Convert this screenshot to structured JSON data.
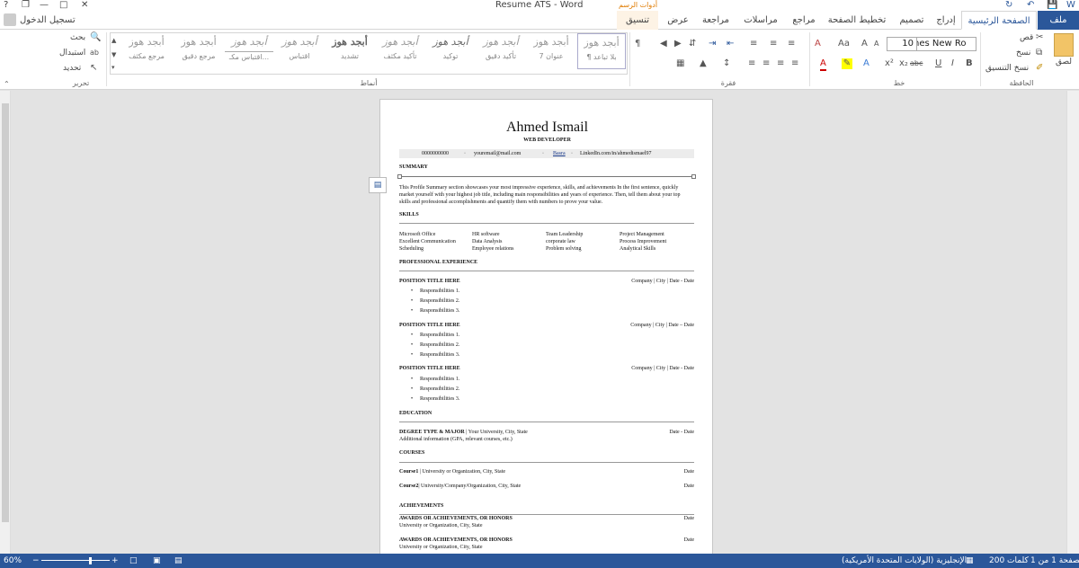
{
  "title_bar": {
    "doc_title": "Resume ATS - Word",
    "context_group": "أدوات الرسم",
    "help": "?",
    "minimize": "—",
    "restore": "❐",
    "close": "✕"
  },
  "tabs": {
    "file": "ملف",
    "home": "الصفحة الرئيسية",
    "insert": "إدراج",
    "design": "تصميم",
    "layout": "تخطيط الصفحة",
    "references": "مراجع",
    "mailings": "مراسلات",
    "review": "مراجعة",
    "view": "عرض",
    "format": "تنسيق",
    "sign_in": "تسجيل الدخول"
  },
  "ribbon": {
    "clipboard": {
      "label": "الحافظة",
      "paste": "لصق",
      "cut": "قص",
      "copy": "نسخ",
      "format_painter": "نسخ التنسيق"
    },
    "font": {
      "label": "خط",
      "name": "Times New Ro",
      "size": "10",
      "bold": "B",
      "italic": "I",
      "underline": "U",
      "strike": "abc",
      "sub": "x₂",
      "sup": "x²",
      "grow": "A",
      "shrink": "A",
      "case": "Aa",
      "clear": "A"
    },
    "paragraph": {
      "label": "فقرة"
    },
    "styles": {
      "label": "أنماط",
      "items": [
        {
          "sample": "أبجد هوز",
          "name": "¶ بلا تباعد"
        },
        {
          "sample": "أبجد هوز",
          "name": "عنوان 7"
        },
        {
          "sample": "أبجد هوز",
          "name": "تأكيد دقيق"
        },
        {
          "sample": "أبجد هوز",
          "name": "توكيد"
        },
        {
          "sample": "أبجد هوز",
          "name": "تأكيد مكثف"
        },
        {
          "sample": "أبجد هوز",
          "name": "تشديد"
        },
        {
          "sample": "أبجد هوز",
          "name": "اقتباس"
        },
        {
          "sample": "أبجد هوز",
          "name": "اقتباس مكـ..."
        },
        {
          "sample": "أبجد هوز",
          "name": "مرجع دقيق"
        },
        {
          "sample": "أبجد هوز",
          "name": "مرجع مكثف"
        }
      ]
    },
    "editing": {
      "label": "تحرير",
      "find": "بحث",
      "replace": "استبدال",
      "select": "تحديد"
    }
  },
  "resume": {
    "name": "Ahmed Ismail",
    "role": "WEB DEVELOPER",
    "phone": "0000000000",
    "email": "youremail@mail.com",
    "city": "Basra",
    "linkedin": "LinkedIn.com/in/ahmedismael97",
    "summary_title": "SUMMARY",
    "summary_l1": "This Profile Summary section showcases your most impressive experience, skills, and achievements In the first sentence, quickly",
    "summary_l2": "market yourself with your highest job title, including main responsibilities and years of experience. Then, tell them about your top",
    "summary_l3": "skills and professional accomplishments and quantify them with numbers to prove your value.",
    "skills_title": "SKILLS",
    "skills": [
      [
        "Microsoft Office",
        "HR software",
        "Team Leadership",
        "Project Management"
      ],
      [
        "Excellent Communication",
        "Data Analysis",
        "corporate law",
        "Process Improvement"
      ],
      [
        "Scheduling",
        "Employee relations",
        "Problem solving",
        "Analytical Skills"
      ]
    ],
    "exp_title": "PROFESSIONAL EXPERIENCE",
    "positions": [
      {
        "title": "POSITION TITLE HERE",
        "meta": "Company | City | Date - Date",
        "r1": "Responsibilities 1.",
        "r2": "Responsibilities 2.",
        "r3": "Responsibilities 3."
      },
      {
        "title": "POSITION TITLE HERE",
        "meta": "Company | City | Date – Date",
        "r1": "Responsibilities 1.",
        "r2": "Responsibilities 2.",
        "r3": "Responsibilities 3."
      },
      {
        "title": "POSITION TITLE HERE",
        "meta": "Company | City | Date - Date",
        "r1": "Responsibilities 1.",
        "r2": "Responsibilities 2.",
        "r3": "Responsibilities 3."
      }
    ],
    "edu_title": "EDUCATION",
    "degree": "DEGREE TYPE & MAJOR",
    "degree_rest": " | Your University, City, State",
    "degree_date": "Date - Date",
    "degree_info": "Additional information (GPA, relevant courses, etc.)",
    "courses_title": "COURSES",
    "course1": "Course1",
    "course1_rest": " | University or Organization, City, State",
    "course1_date": "Date",
    "course2": "Course2",
    "course2_rest": "| University/Company/Organization, City, State",
    "course2_date": "Date",
    "ach_title": "ACHIEVEMENTS",
    "award1": "AWARDS OR ACHIEVEMENTS, OR HONORS",
    "award1_org": "University or Organization, City, State",
    "award1_date": "Date",
    "award2": "AWARDS OR ACHIEVEMENTS, OR HONORS",
    "award2_org": "University or Organization, City, State",
    "award2_date": "Date"
  },
  "status_bar": {
    "page": "الصفحة 1 من 1",
    "words": "200 كلمات",
    "language": "الإنجليزية (الولايات المتحدة الأمريكية)",
    "zoom": "60%"
  },
  "colors": {
    "accent": "#2b579a",
    "context": "#e07b00"
  }
}
